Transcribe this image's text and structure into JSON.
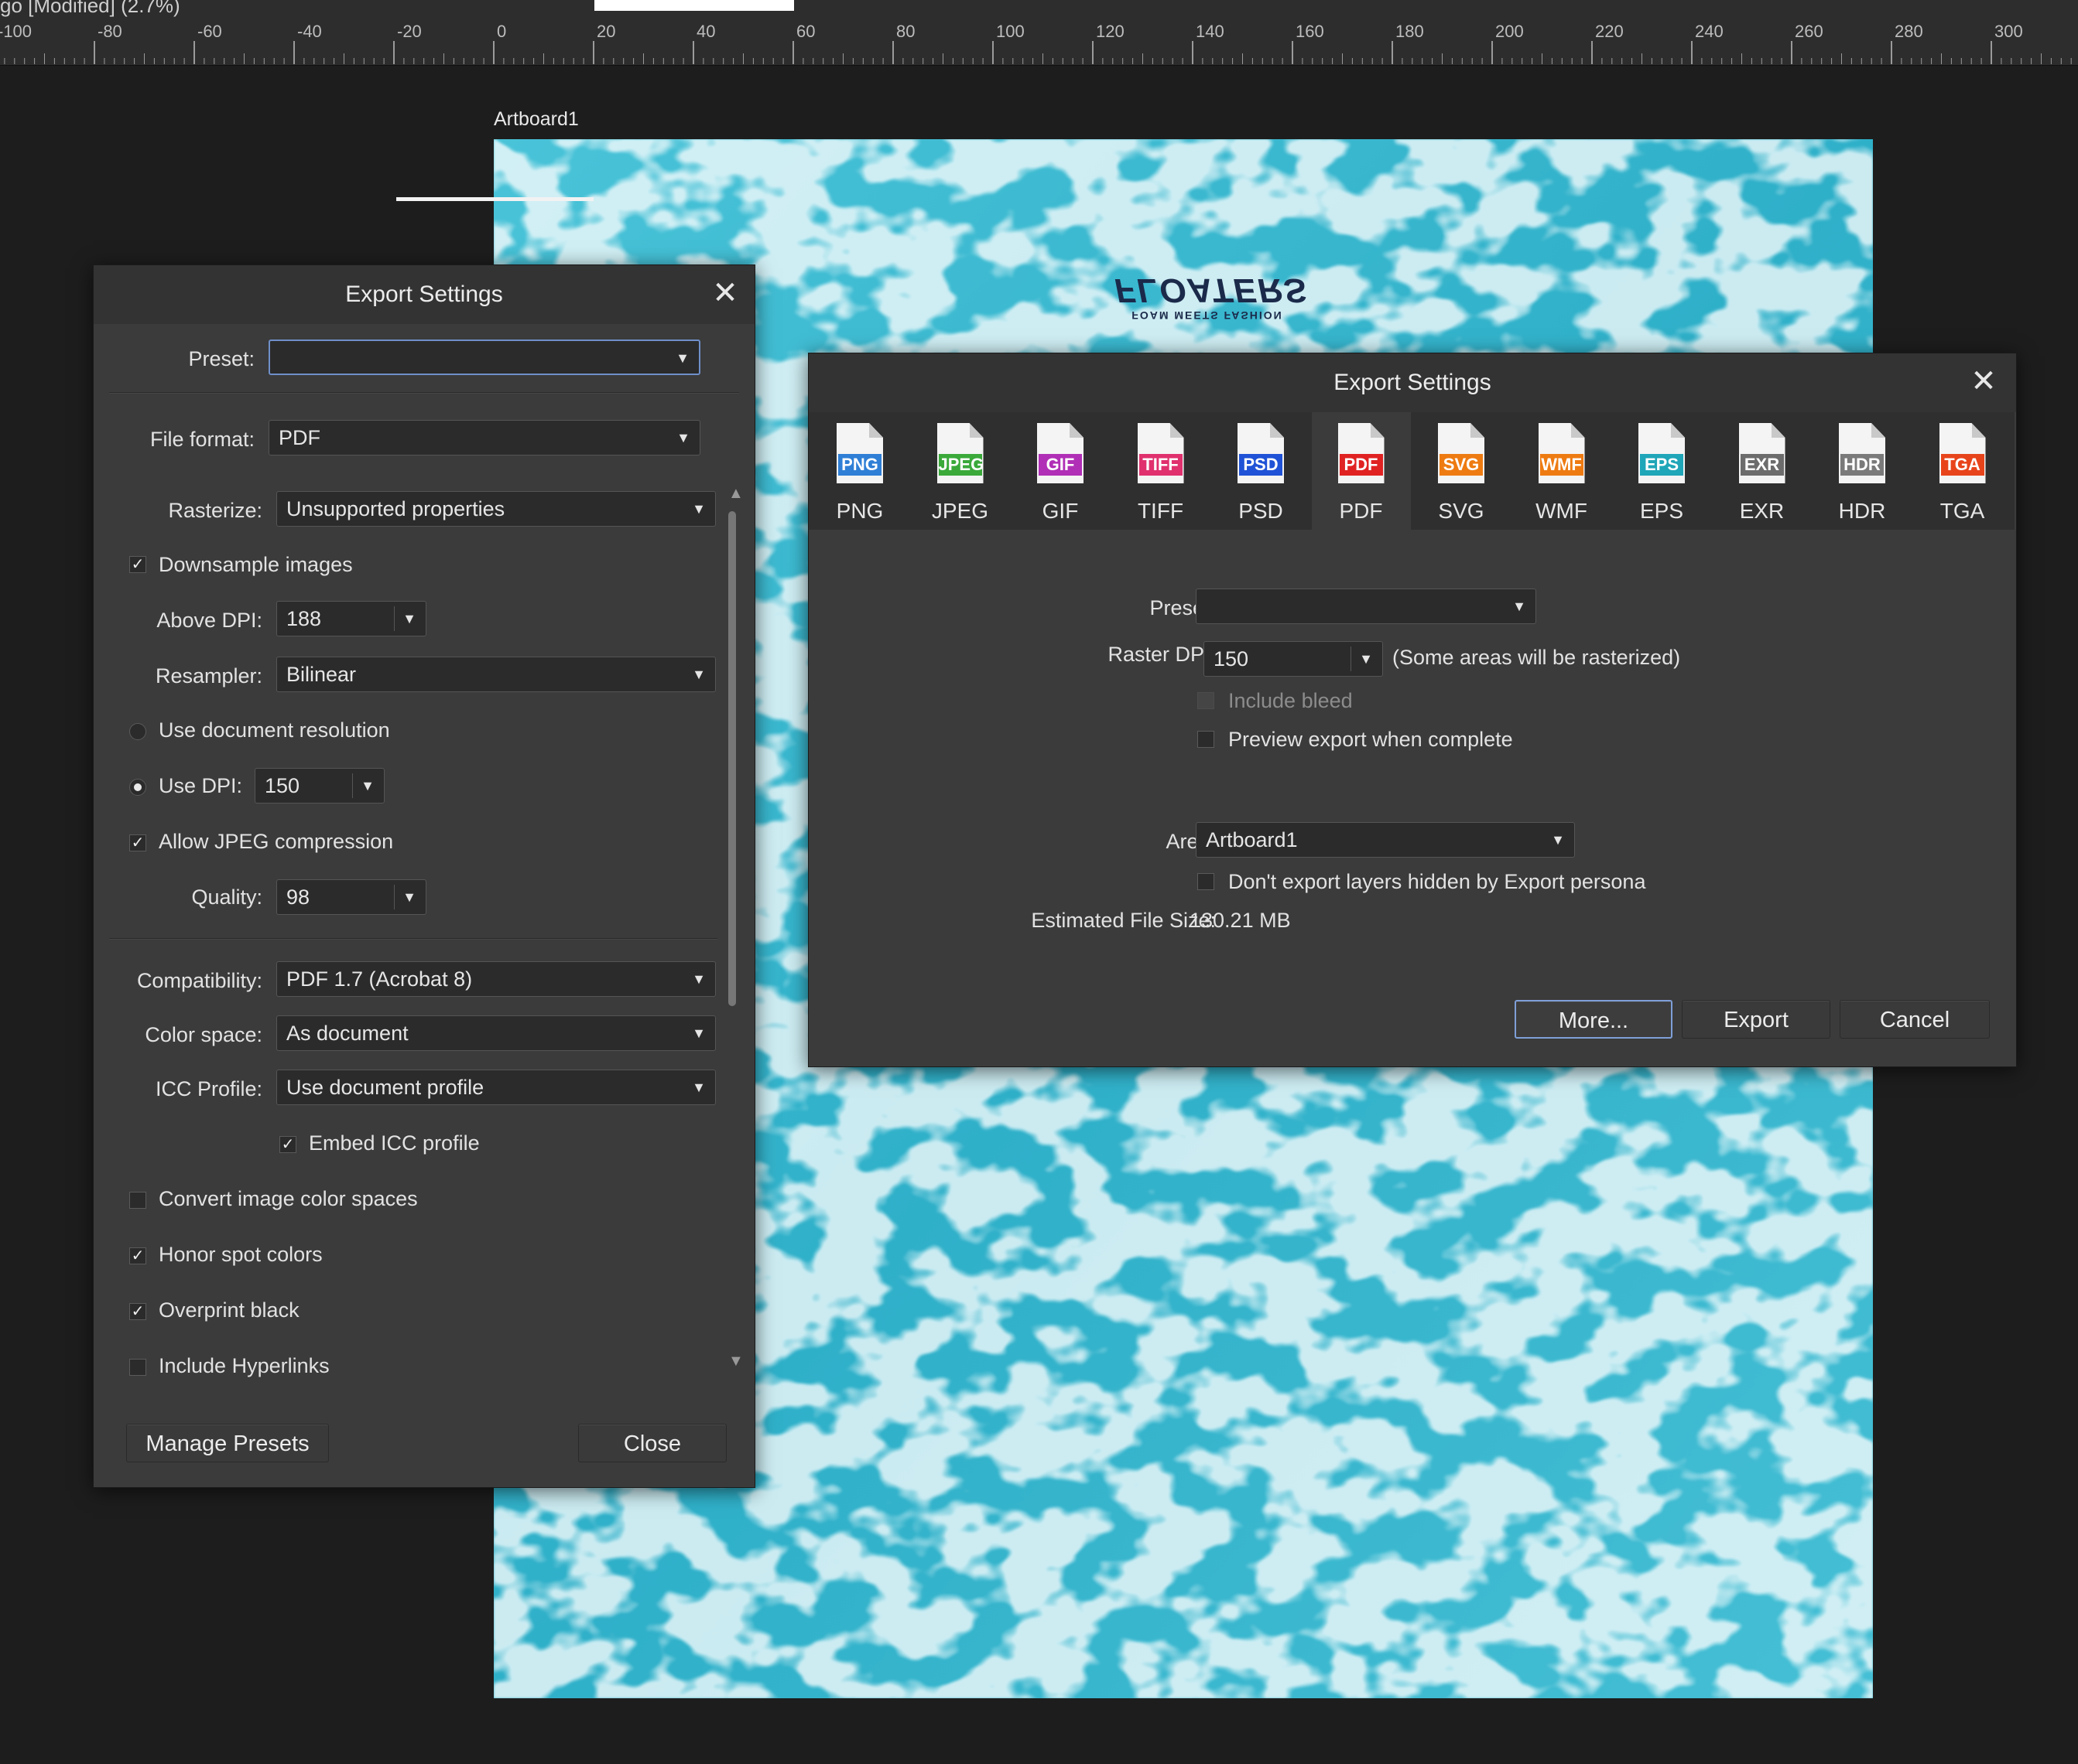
{
  "window_title": "go [Modified] (2.7%)",
  "ruler": {
    "ticks": [
      "-100",
      "-80",
      "-60",
      "-40",
      "-20",
      "0",
      "20",
      "40",
      "60",
      "80",
      "100",
      "120",
      "140",
      "160",
      "180",
      "200",
      "220",
      "240",
      "260",
      "280",
      "300"
    ]
  },
  "artboard": {
    "label": "Artboard1",
    "logo_main": "FLOATERS",
    "logo_tag": "FOAM MEETS FASHION"
  },
  "export_settings_more": {
    "title": "Export Settings",
    "preset_label": "Preset:",
    "preset_value": "",
    "file_format_label": "File format:",
    "file_format_value": "PDF",
    "rasterize_label": "Rasterize:",
    "rasterize_value": "Unsupported properties",
    "downsample_label": "Downsample images",
    "above_dpi_label": "Above DPI:",
    "above_dpi_value": "188",
    "resampler_label": "Resampler:",
    "resampler_value": "Bilinear",
    "use_doc_res_label": "Use document resolution",
    "use_dpi_label": "Use DPI:",
    "use_dpi_value": "150",
    "allow_jpeg_label": "Allow JPEG compression",
    "quality_label": "Quality:",
    "quality_value": "98",
    "compat_label": "Compatibility:",
    "compat_value": "PDF 1.7 (Acrobat 8)",
    "colorspace_label": "Color space:",
    "colorspace_value": "As document",
    "icc_label": "ICC Profile:",
    "icc_value": "Use document profile",
    "embed_icc_label": "Embed ICC profile",
    "convert_cs_label": "Convert image color spaces",
    "honor_spot_label": "Honor spot colors",
    "overprint_label": "Overprint black",
    "hyperlinks_label": "Include Hyperlinks",
    "manage_presets": "Manage Presets",
    "close": "Close"
  },
  "export_settings_main": {
    "title": "Export Settings",
    "formats": [
      {
        "badge": "PNG",
        "label": "PNG",
        "color": "#2f7fd6"
      },
      {
        "badge": "JPEG",
        "label": "JPEG",
        "color": "#3aa93a"
      },
      {
        "badge": "GIF",
        "label": "GIF",
        "color": "#b02fb6"
      },
      {
        "badge": "TIFF",
        "label": "TIFF",
        "color": "#e0306e"
      },
      {
        "badge": "PSD",
        "label": "PSD",
        "color": "#1f52d6"
      },
      {
        "badge": "PDF",
        "label": "PDF",
        "color": "#e02222"
      },
      {
        "badge": "SVG",
        "label": "SVG",
        "color": "#ee7b12"
      },
      {
        "badge": "WMF",
        "label": "WMF",
        "color": "#ee7b12"
      },
      {
        "badge": "EPS",
        "label": "EPS",
        "color": "#1fa6b8"
      },
      {
        "badge": "EXR",
        "label": "EXR",
        "color": "#6c6c6c"
      },
      {
        "badge": "HDR",
        "label": "HDR",
        "color": "#7a7a7a"
      },
      {
        "badge": "TGA",
        "label": "TGA",
        "color": "#e8441c"
      }
    ],
    "active_format": 5,
    "preset_label": "Preset:",
    "preset_value": "",
    "raster_dpi_label": "Raster DPI:",
    "raster_dpi_value": "150",
    "raster_note": "(Some areas will be rasterized)",
    "include_bleed_label": "Include bleed",
    "preview_label": "Preview export when complete",
    "area_label": "Area:",
    "area_value": "Artboard1",
    "hidden_layers_label": "Don't export layers hidden by Export persona",
    "est_size_label": "Estimated File Size:",
    "est_size_value": "130.21 MB",
    "more": "More...",
    "export": "Export",
    "cancel": "Cancel"
  }
}
